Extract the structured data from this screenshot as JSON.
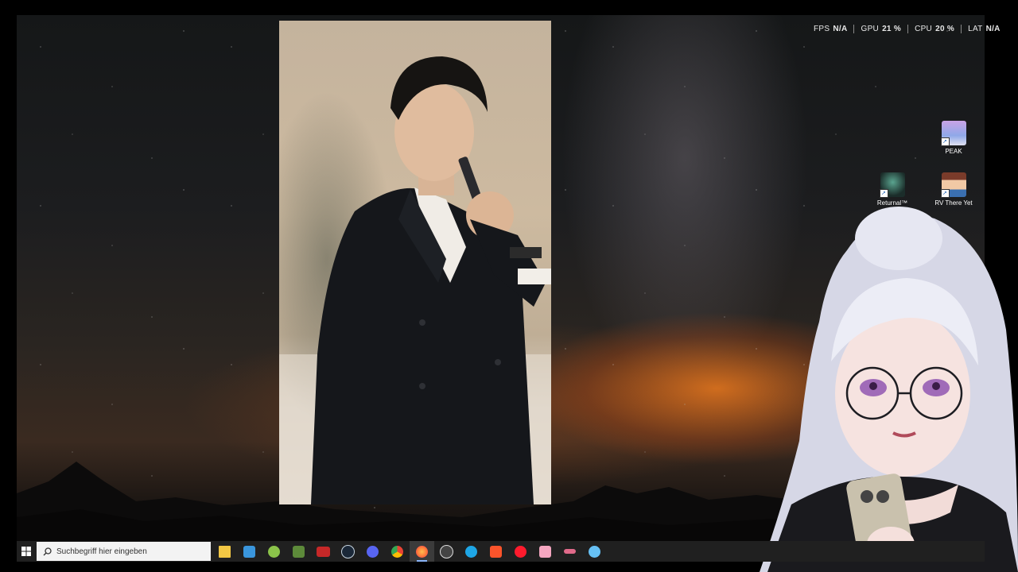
{
  "overlay": {
    "fps": {
      "label": "FPS",
      "value": "N/A"
    },
    "gpu": {
      "label": "GPU",
      "value": "21 %"
    },
    "cpu": {
      "label": "CPU",
      "value": "20 %"
    },
    "lat": {
      "label": "LAT",
      "value": "N/A"
    }
  },
  "desktop_icons": [
    {
      "label": "PEAK",
      "icon": "peak-game-icon"
    },
    {
      "label": "Returnal™",
      "icon": "returnal-game-icon"
    },
    {
      "label": "RV There Yet",
      "icon": "rv-there-yet-game-icon"
    }
  ],
  "taskbar": {
    "search_placeholder": "Suchbegriff hier eingeben",
    "apps": [
      {
        "name": "file-explorer-icon",
        "color": "#f2c744"
      },
      {
        "name": "microsoft-store-icon",
        "color": "#3a96dd"
      },
      {
        "name": "android-app-icon",
        "color": "#8bc34a"
      },
      {
        "name": "minecraft-icon",
        "color": "#5d8a3a"
      },
      {
        "name": "game-launcher-icon",
        "color": "#c62828"
      },
      {
        "name": "steam-icon",
        "color": "#1b2838"
      },
      {
        "name": "discord-icon",
        "color": "#5865f2"
      },
      {
        "name": "chrome-icon",
        "color": "#4caf50"
      },
      {
        "name": "firefox-icon",
        "color": "#ff7139"
      },
      {
        "name": "speedometer-icon",
        "color": "#444444"
      },
      {
        "name": "battlenet-icon",
        "color": "#1ea6e6"
      },
      {
        "name": "brave-icon",
        "color": "#fb542b"
      },
      {
        "name": "opera-icon",
        "color": "#ff1b2d"
      },
      {
        "name": "photo-app-icon",
        "color": "#f4a6c0"
      },
      {
        "name": "app-icon",
        "color": "#e06a8a"
      },
      {
        "name": "steam-helper-icon",
        "color": "#66c0f4"
      }
    ],
    "active_app": "firefox-icon"
  }
}
